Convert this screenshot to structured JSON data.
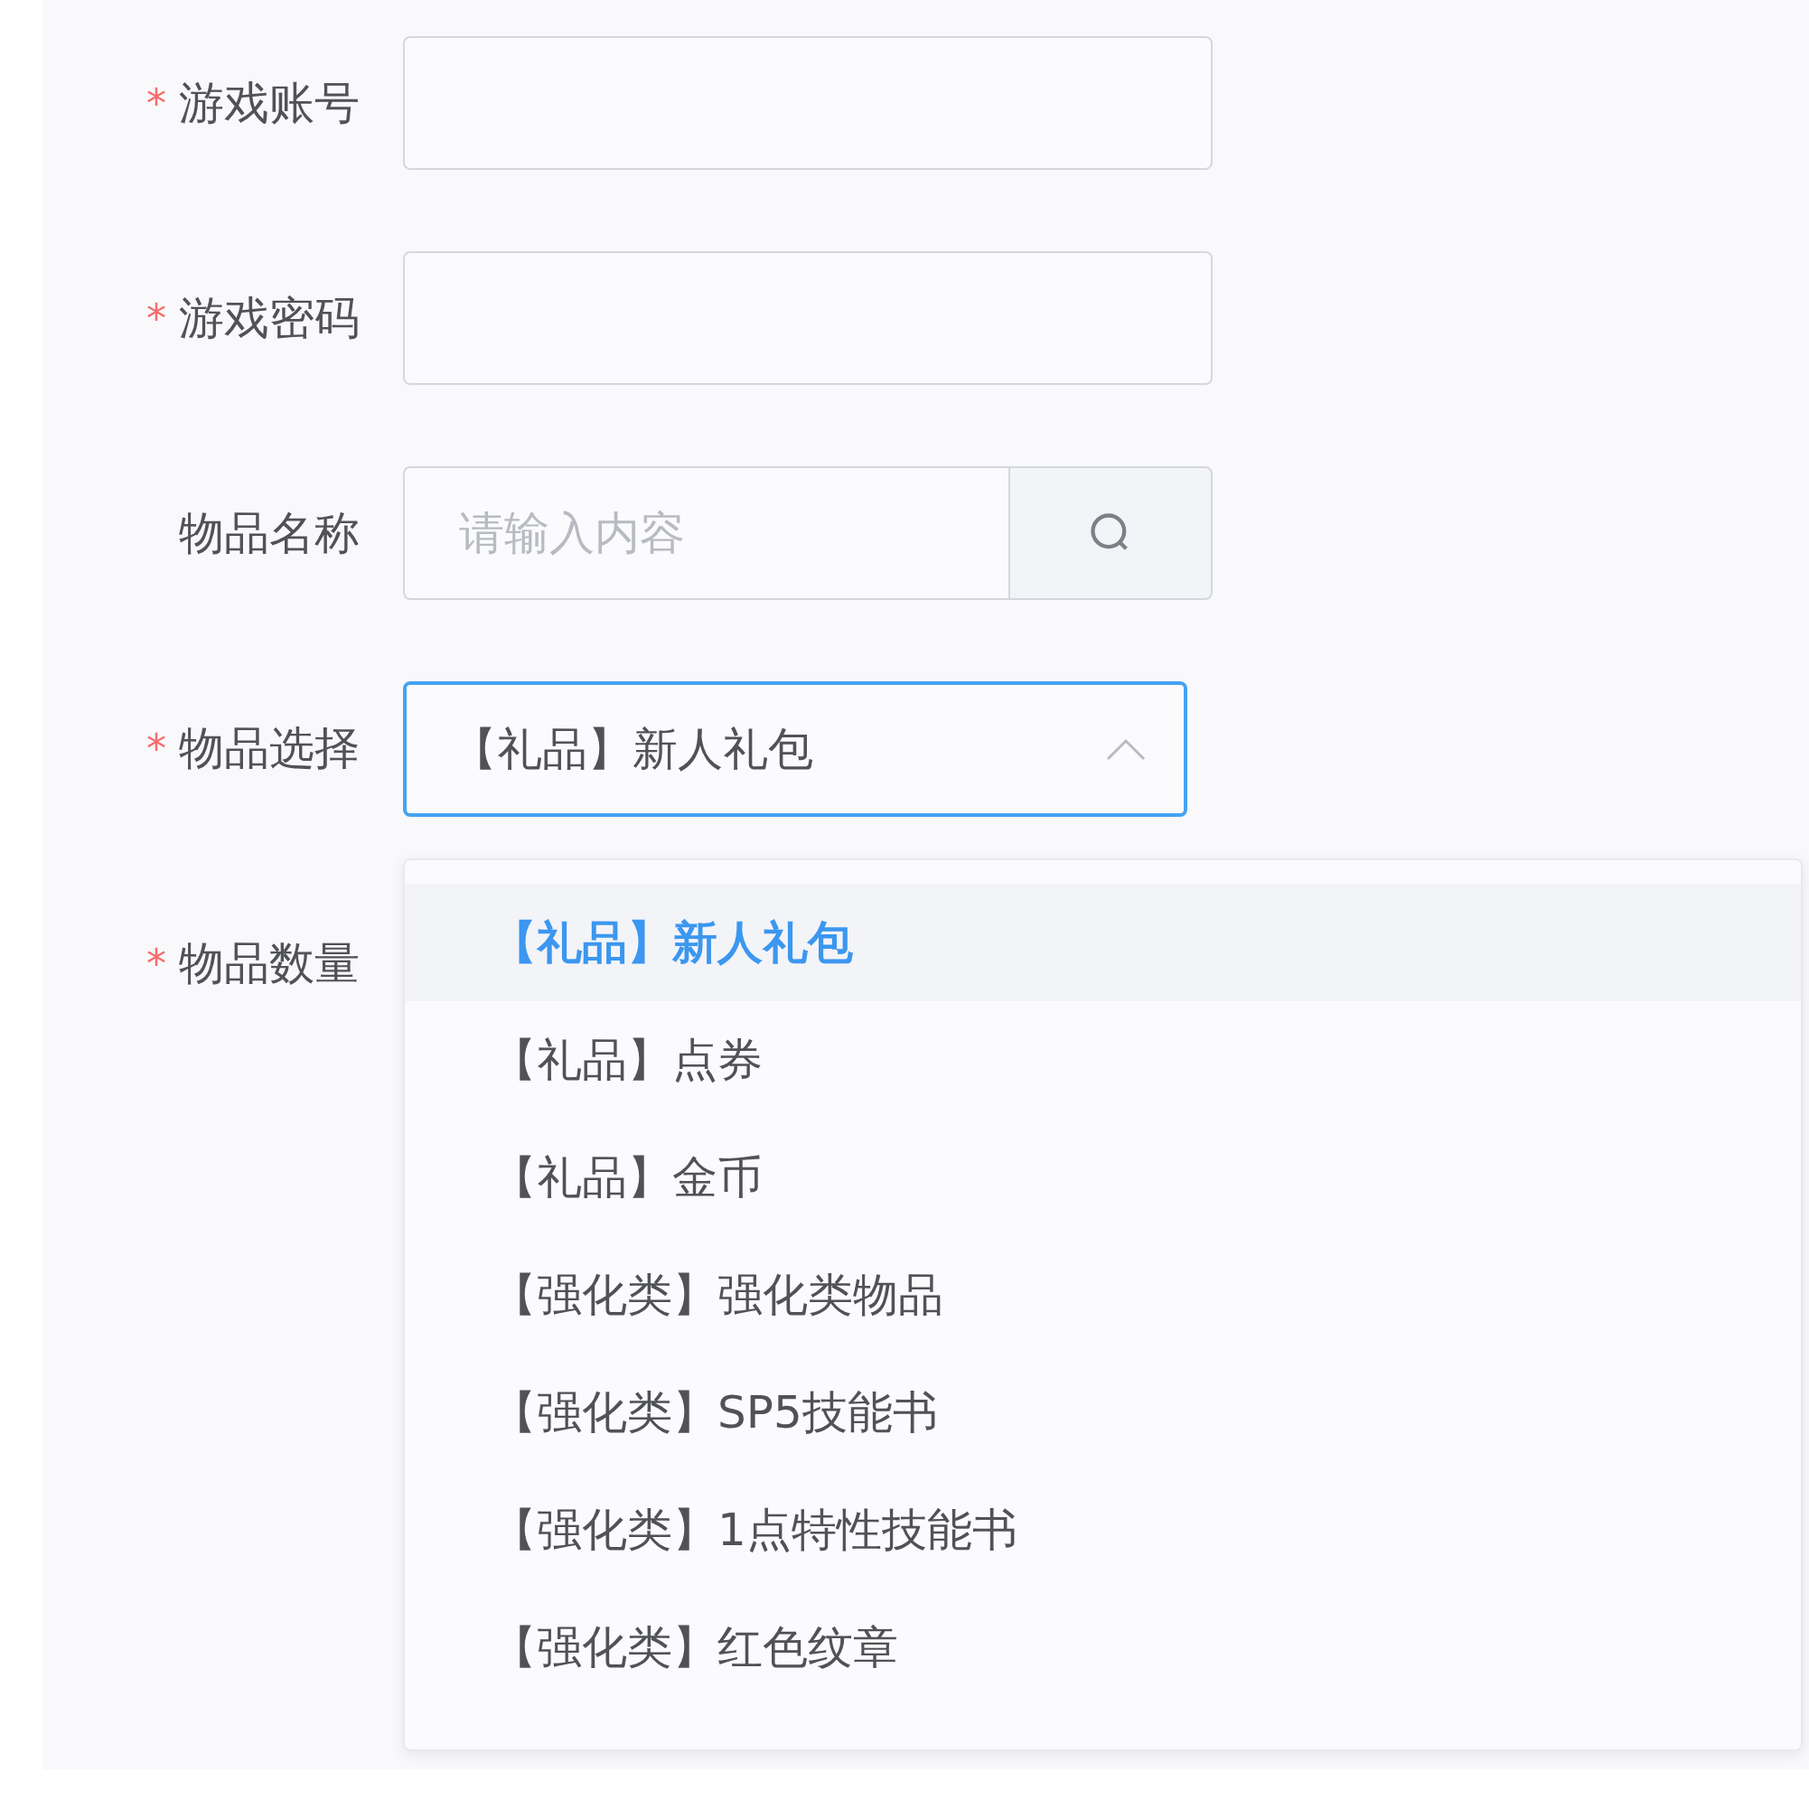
{
  "form": {
    "fields": [
      {
        "kind": "text",
        "label": "游戏账号",
        "required": true
      },
      {
        "kind": "text",
        "label": "游戏密码",
        "required": true
      },
      {
        "kind": "search",
        "label": "物品名称",
        "required": false,
        "placeholder": "请输入内容"
      },
      {
        "kind": "select",
        "label": "物品选择",
        "required": true,
        "value": "【礼品】新人礼包",
        "expanded": true
      },
      {
        "kind": "hidden",
        "label": "物品数量",
        "required": true
      }
    ]
  },
  "required_mark": "*",
  "dropdown": {
    "options": [
      {
        "label": "【礼品】新人礼包",
        "selected": true
      },
      {
        "label": "【礼品】点券",
        "selected": false
      },
      {
        "label": "【礼品】金币",
        "selected": false
      },
      {
        "label": "【强化类】强化类物品",
        "selected": false
      },
      {
        "label": "【强化类】SP5技能书",
        "selected": false
      },
      {
        "label": "【强化类】1点特性技能书",
        "selected": false
      },
      {
        "label": "【强化类】红色纹章",
        "selected": false
      }
    ]
  }
}
